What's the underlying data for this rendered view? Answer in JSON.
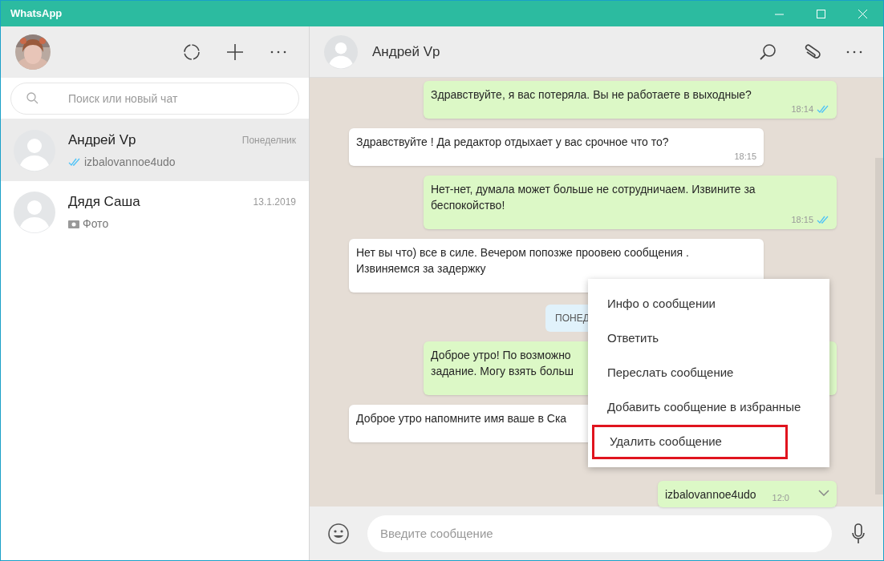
{
  "window": {
    "title": "WhatsApp"
  },
  "sidebar": {
    "search": {
      "placeholder": "Поиск или новый чат"
    },
    "chats": [
      {
        "name": "Андрей Vp",
        "time": "Понеделник",
        "preview": "izbalovannoe4udo",
        "kind": "read",
        "selected": true
      },
      {
        "name": "Дядя Саша",
        "time": "13.1.2019",
        "preview": "Фото",
        "selected": false
      }
    ]
  },
  "conversation": {
    "contact": "Андрей Vp",
    "messages": [
      {
        "kind": "out",
        "lines": [
          "Здравствуйте, я вас потеряла. Вы не работаете в выходные?"
        ],
        "time": "18:14",
        "read": true
      },
      {
        "kind": "in",
        "lines": [
          "Здравствуйте ! Да редактор отдыхает у вас срочное что то?"
        ],
        "time": "18:15"
      },
      {
        "kind": "out",
        "lines": [
          "Нет-нет, думала может больше не сотрудничаем. Извините за",
          "беспокойство!"
        ],
        "time": "18:15",
        "read": true
      },
      {
        "kind": "in",
        "lines": [
          "Нет вы что) все в силе. Вечером попозже проовею сообщения .",
          "Извиняемся за задержку"
        ]
      },
      {
        "kind": "date",
        "lines": [
          "ПОНЕД"
        ]
      },
      {
        "kind": "out",
        "lines": [
          "Доброе утро! По возможно",
          "задание. Могу взять больш"
        ]
      },
      {
        "kind": "in",
        "lines": [
          "Доброе утро напомните имя ваше в Ска"
        ]
      },
      {
        "kind": "out_short",
        "lines": [
          "izbalovannoe4udo"
        ],
        "time": "12:0"
      }
    ],
    "input": {
      "placeholder": "Введите сообщение"
    }
  },
  "context_menu": {
    "items": [
      {
        "label": "Инфо о сообщении",
        "highlighted": false
      },
      {
        "label": "Ответить",
        "highlighted": false
      },
      {
        "label": "Переслать сообщение",
        "highlighted": false
      },
      {
        "label": "Добавить сообщение в избранные",
        "highlighted": false
      },
      {
        "label": "Удалить сообщение",
        "highlighted": true
      }
    ]
  }
}
